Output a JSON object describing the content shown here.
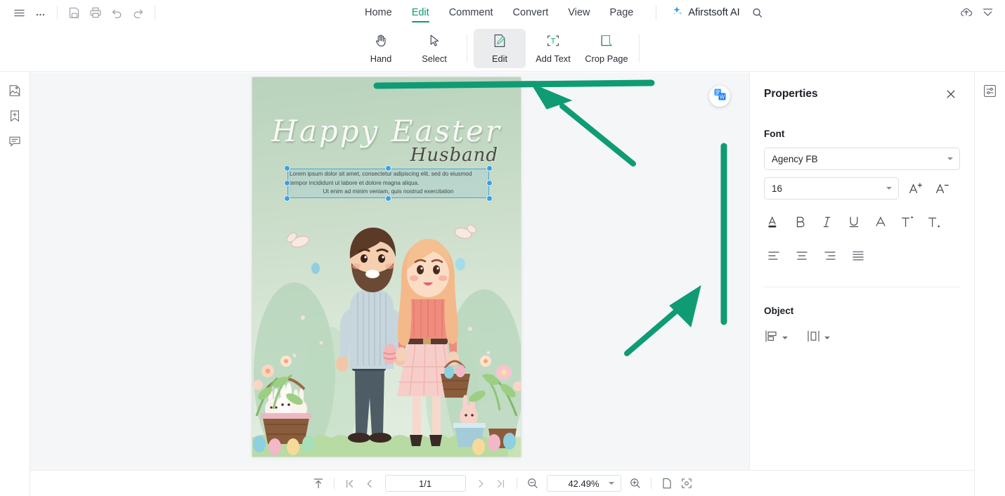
{
  "header": {
    "left_icons": [
      {
        "name": "menu-icon",
        "glyph": "hamburger"
      },
      {
        "name": "more-options-icon",
        "glyph": "ellipsis"
      },
      {
        "name": "save-icon",
        "glyph": "save"
      },
      {
        "name": "print-icon",
        "glyph": "print"
      },
      {
        "name": "undo-icon",
        "glyph": "undo"
      },
      {
        "name": "redo-icon",
        "glyph": "redo"
      }
    ],
    "menu": [
      {
        "label": "Home",
        "active": false
      },
      {
        "label": "Edit",
        "active": true
      },
      {
        "label": "Comment",
        "active": false
      },
      {
        "label": "Convert",
        "active": false
      },
      {
        "label": "View",
        "active": false
      },
      {
        "label": "Page",
        "active": false
      }
    ],
    "ai_label": "Afirstsoft AI",
    "right_icons": [
      {
        "name": "search-icon"
      },
      {
        "name": "cloud-upload-icon"
      },
      {
        "name": "collapse-ribbon-icon"
      }
    ],
    "accent_color": "#0f9b74"
  },
  "toolbar": {
    "tools": [
      {
        "label": "Hand",
        "icon": "hand-icon",
        "active": false
      },
      {
        "label": "Select",
        "icon": "cursor-icon",
        "active": false
      },
      {
        "label": "Edit",
        "icon": "edit-pencil-icon",
        "active": true
      },
      {
        "label": "Add Text",
        "icon": "add-text-icon",
        "active": false
      },
      {
        "label": "Crop Page",
        "icon": "crop-page-icon",
        "active": false
      }
    ]
  },
  "left_rail": {
    "items": [
      {
        "name": "thumbnails-panel-icon"
      },
      {
        "name": "bookmark-add-icon"
      },
      {
        "name": "comments-panel-icon"
      }
    ]
  },
  "right_rail": {
    "items": [
      {
        "name": "properties-panel-icon"
      }
    ]
  },
  "canvas": {
    "background": "#f4f6f8",
    "translate_button": "translate-icon",
    "page": {
      "title": "Happy Easter",
      "subtitle": "Husband",
      "selected_textbox": {
        "line1": "Lorem ipsum dolor sit amet, consectetur adipiscing elit, sed do",
        "line2": "eiusmod tempor incididunt ut labore et dolore magna aliqua.",
        "line3": "Ut enim ad minim veniam, quis nostrud exercitation",
        "handle_color": "#3aa0e0",
        "border_color": "#46a7dd"
      },
      "illustration": "easter-couple-illustration"
    },
    "annotations": {
      "color": "#0f9b74",
      "shapes": [
        "horizontal-line",
        "arrow-up-left",
        "vertical-line",
        "arrow-up-right"
      ]
    }
  },
  "properties": {
    "title": "Properties",
    "close_icon": "close-icon",
    "font_section_label": "Font",
    "font_family": "Agency FB",
    "font_size": "16",
    "increase_size_icon": "increase-font-size-icon",
    "decrease_size_icon": "decrease-font-size-icon",
    "format_buttons": [
      {
        "name": "font-color-button",
        "glyph": "A"
      },
      {
        "name": "bold-button",
        "glyph": "B"
      },
      {
        "name": "italic-button",
        "glyph": "I"
      },
      {
        "name": "underline-button",
        "glyph": "U"
      },
      {
        "name": "strikethrough-button",
        "glyph": "A"
      },
      {
        "name": "superscript-button",
        "glyph": "T"
      },
      {
        "name": "subscript-button",
        "glyph": "T"
      }
    ],
    "align_buttons": [
      {
        "name": "align-left-button"
      },
      {
        "name": "align-center-button"
      },
      {
        "name": "align-right-button"
      },
      {
        "name": "align-justify-button"
      }
    ],
    "object_section_label": "Object",
    "object_buttons": [
      {
        "name": "align-objects-button"
      },
      {
        "name": "distribute-objects-button"
      }
    ]
  },
  "statusbar": {
    "fit_top_icon": "scroll-to-top-icon",
    "first_page_icon": "first-page-icon",
    "prev_page_icon": "previous-page-icon",
    "page_value": "1/1",
    "next_page_icon": "next-page-icon",
    "last_page_icon": "last-page-icon",
    "zoom_out_icon": "zoom-out-icon",
    "zoom_value": "42.49%",
    "zoom_in_icon": "zoom-in-icon",
    "single_page_icon": "single-page-view-icon",
    "fit_page_icon": "fit-page-icon"
  }
}
